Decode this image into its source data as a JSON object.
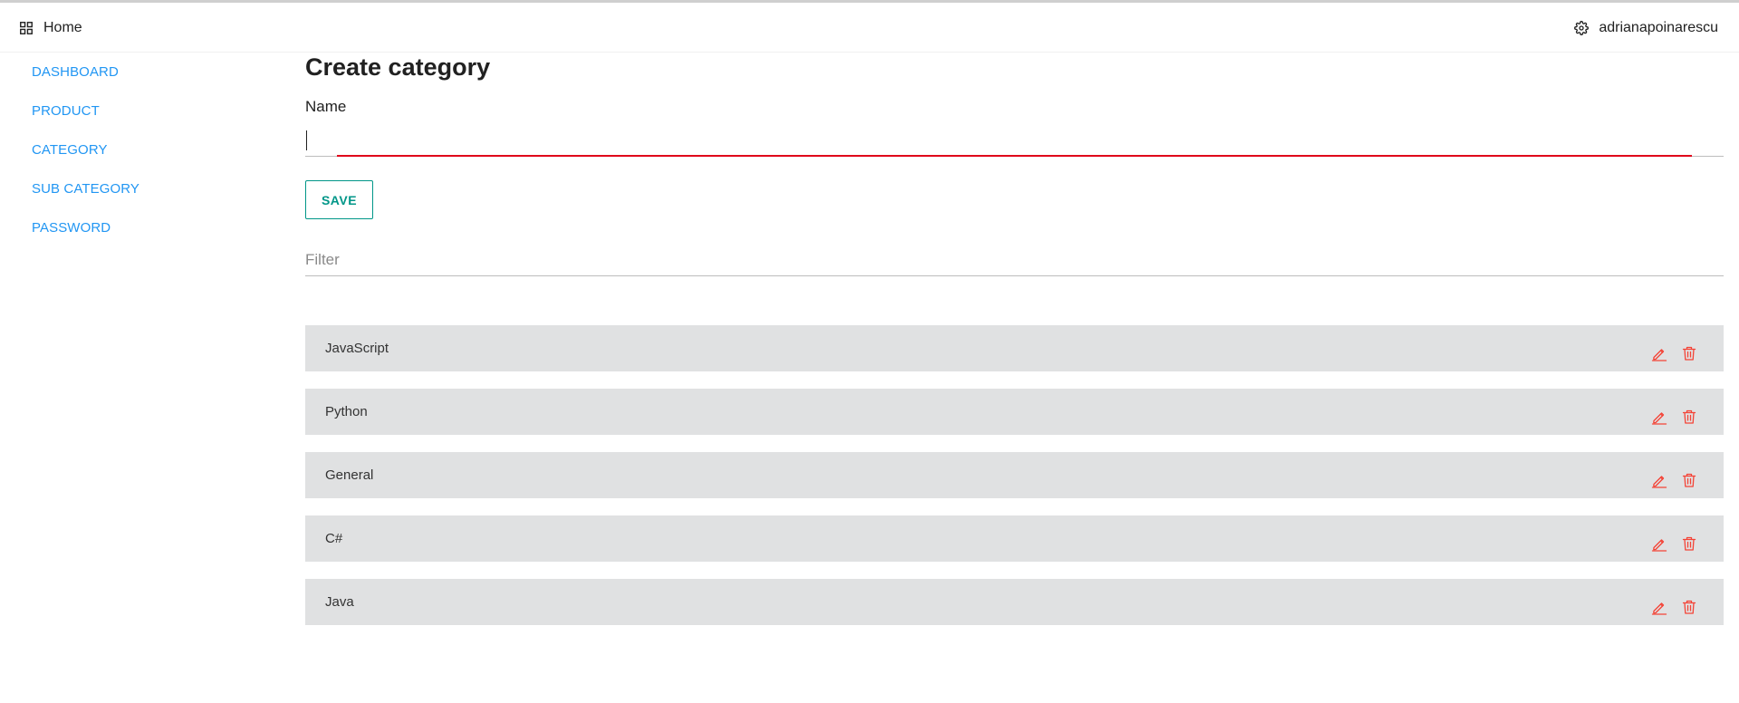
{
  "topbar": {
    "home_label": "Home",
    "user_label": "adrianapoinarescu",
    "home_icon": "grid-icon",
    "user_icon": "gear-icon"
  },
  "sidebar": {
    "items": [
      {
        "label": "DASHBOARD"
      },
      {
        "label": "PRODUCT"
      },
      {
        "label": "CATEGORY"
      },
      {
        "label": "SUB CATEGORY"
      },
      {
        "label": "PASSWORD"
      }
    ]
  },
  "form": {
    "title": "Create category",
    "name_label": "Name",
    "name_value": "",
    "save_label": "SAVE"
  },
  "filter": {
    "placeholder": "Filter",
    "value": ""
  },
  "categories": [
    {
      "name": "JavaScript"
    },
    {
      "name": "Python"
    },
    {
      "name": "General"
    },
    {
      "name": "C#"
    },
    {
      "name": "Java"
    }
  ],
  "colors": {
    "accent_link": "#2196f3",
    "save_button": "#009688",
    "error_line": "#e0001a",
    "action_icons": "#f44336",
    "list_item_bg": "#e0e1e2"
  },
  "icons": {
    "edit": "pencil-icon",
    "delete": "trash-icon"
  }
}
